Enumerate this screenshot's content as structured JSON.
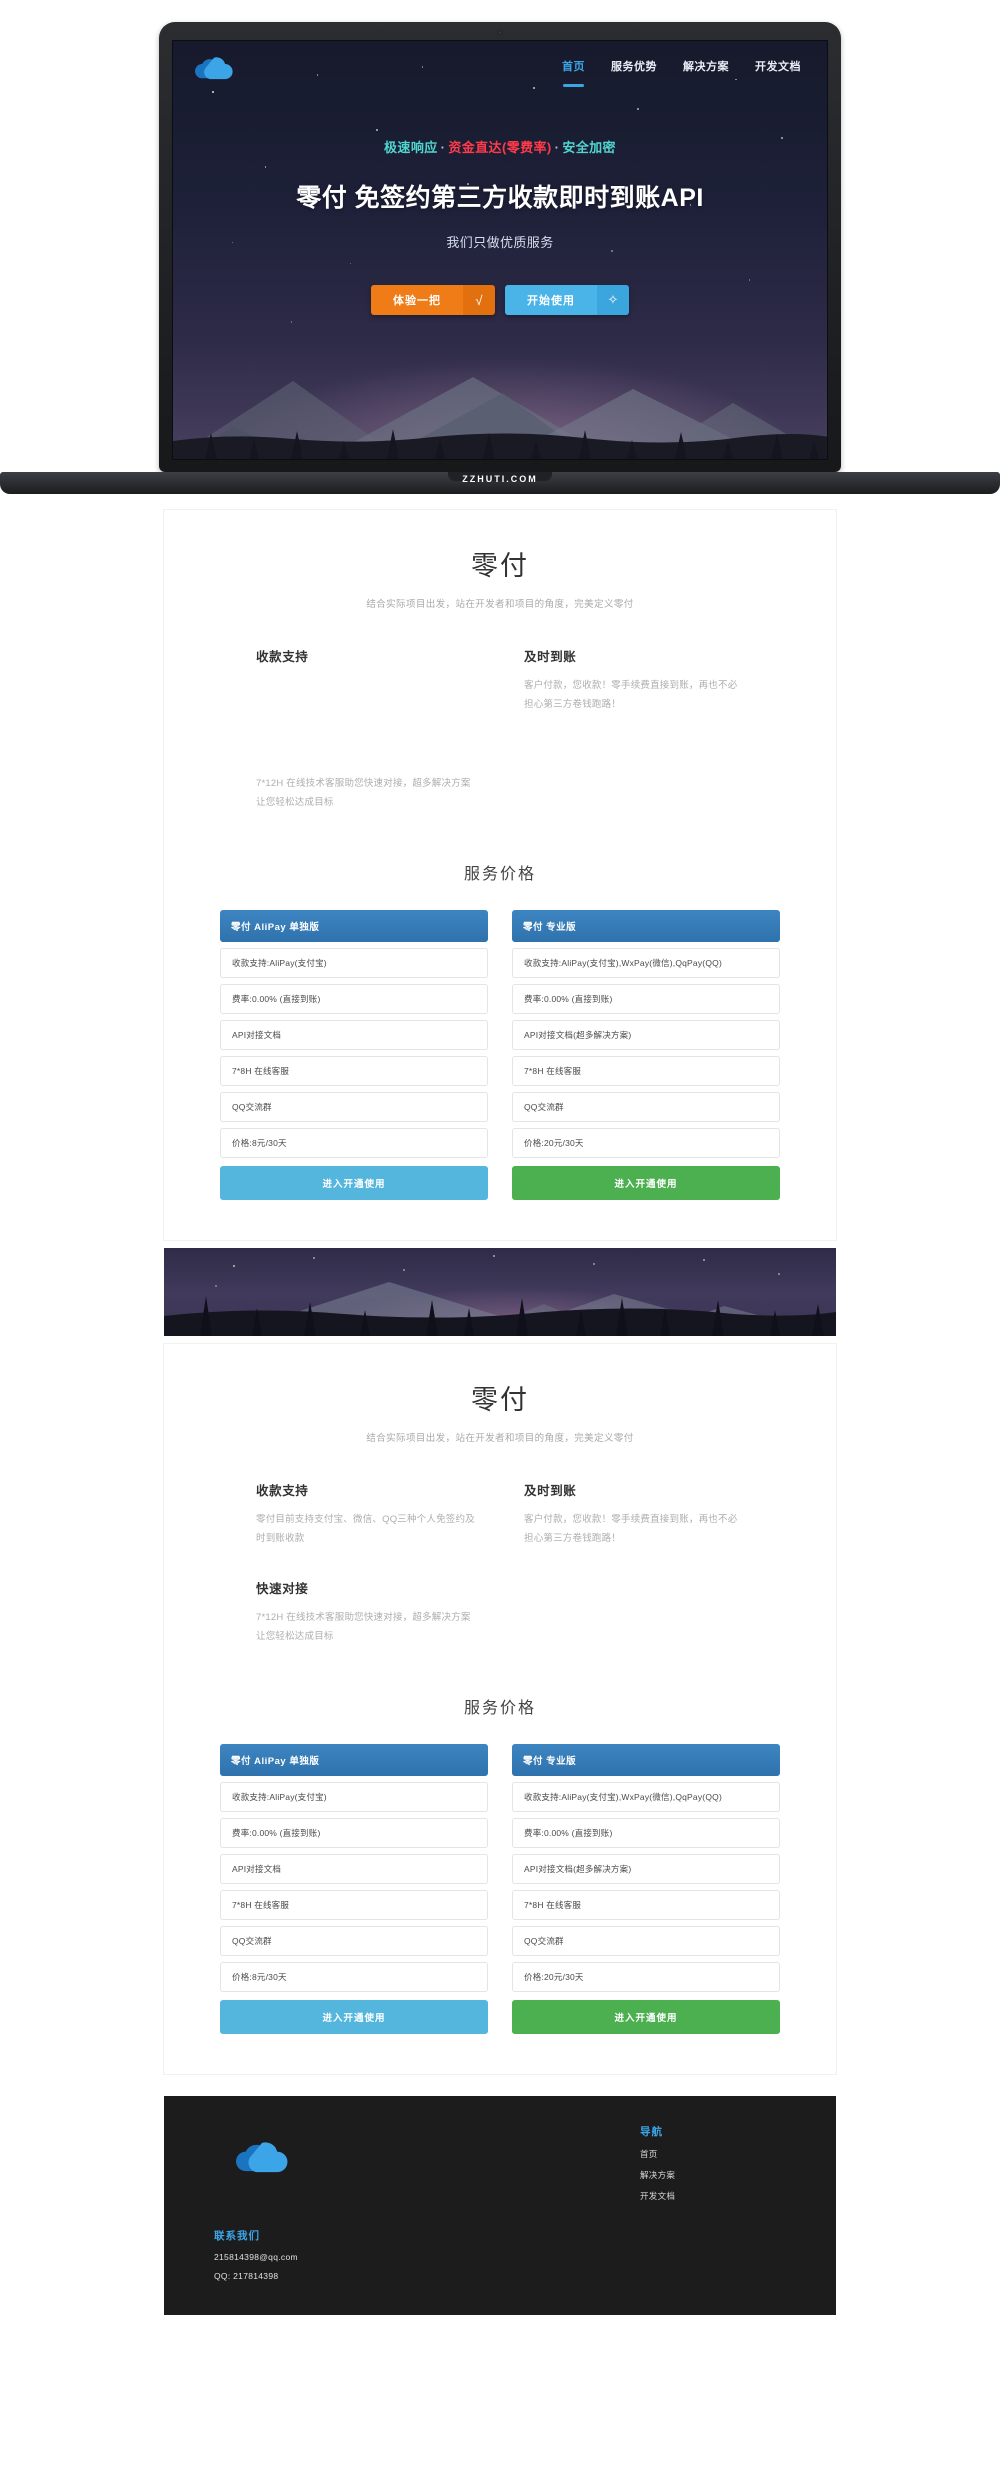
{
  "brand": {
    "logo_icon": "cloud-logo-icon",
    "color_dark": "#1b74c0",
    "color_light": "#3ca5e8"
  },
  "laptop": {
    "watermark": "ZZHUTI.COM"
  },
  "nav": {
    "items": [
      {
        "label": "首页",
        "active": true
      },
      {
        "label": "服务优势",
        "active": false
      },
      {
        "label": "解决方案",
        "active": false
      },
      {
        "label": "开发文档",
        "active": false
      }
    ]
  },
  "hero": {
    "tagline_parts": [
      "极速响应",
      "·",
      "资金直达(零费率)",
      "·",
      "安全加密"
    ],
    "tagline_teal_1": "极速响应",
    "tagline_red": "资金直达(零费率)",
    "tagline_teal_2": "安全加密",
    "dot": "·",
    "title": "零付 免签约第三方收款即时到账API",
    "subtitle": "我们只做优质服务",
    "buttons": [
      {
        "label": "体验一把",
        "icon": "check-radical-icon",
        "glyph": "√",
        "color": "#f07c17"
      },
      {
        "label": "开始使用",
        "icon": "compass-diamond-icon",
        "glyph": "✧",
        "color": "#4ab3e8"
      }
    ]
  },
  "about": {
    "title": "零付",
    "subtitle": "结合实际项目出发，站在开发者和项目的角度，完美定义零付",
    "features": [
      {
        "heading": "收款支持",
        "body": "零付目前支持支付宝、微信、QQ三种个人免签约及时到账收款"
      },
      {
        "heading": "及时到账",
        "body": "客户付款，您收款！零手续费直接到账，再也不必担心第三方卷钱跑路！"
      },
      {
        "heading": "快速对接",
        "body": "7*12H 在线技术客服助您快速对接，超多解决方案让您轻松达成目标"
      }
    ]
  },
  "pricing": {
    "title": "服务价格",
    "plans": [
      {
        "name": "零付 AliPay 单独版",
        "rows": [
          "收款支持:AliPay(支付宝)",
          "费率:0.00% (直接到账)",
          "API对接文档",
          "7*8H 在线客服",
          "QQ交流群",
          "价格:8元/30天"
        ],
        "cta": "进入开通使用",
        "cta_color": "#54b6dd"
      },
      {
        "name": "零付 专业版",
        "rows": [
          "收款支持:AliPay(支付宝),WxPay(微信),QqPay(QQ)",
          "费率:0.00% (直接到账)",
          "API对接文档(超多解决方案)",
          "7*8H 在线客服",
          "QQ交流群",
          "价格:20元/30天"
        ],
        "cta": "进入开通使用",
        "cta_color": "#4caf50"
      }
    ]
  },
  "footer": {
    "logo_icon": "cloud-logo-icon",
    "nav_heading": "导航",
    "nav_items": [
      "首页",
      "解决方案",
      "开发文档"
    ],
    "contact_heading": "联系我们",
    "contact_lines": [
      "215814398@qq.com",
      "QQ: 217814398"
    ]
  }
}
